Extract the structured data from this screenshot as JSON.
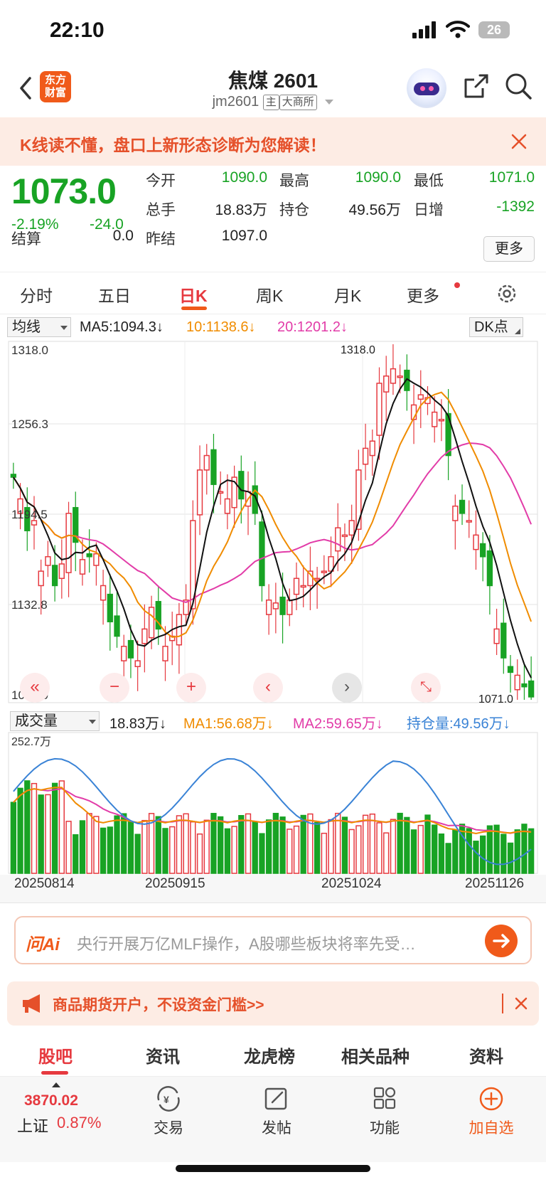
{
  "status_bar": {
    "time": "22:10",
    "battery": "26"
  },
  "header": {
    "logo_line1": "东方",
    "logo_line2": "财富",
    "title": "焦煤 2601",
    "code": "jm2601",
    "tag_main": "主",
    "tag_exchange": "大商所"
  },
  "banner": {
    "text": "K线读不懂，盘口上新形态诊断为您解读！"
  },
  "quote": {
    "price": "1073.0",
    "change_pct": "-2.19%",
    "change": "-24.0",
    "settle_label": "结算",
    "settle": "0.0",
    "prev_settle_label": "昨结",
    "prev_settle": "1097.0",
    "open_label": "今开",
    "open": "1090.0",
    "high_label": "最高",
    "high": "1090.0",
    "low_label": "最低",
    "low": "1071.0",
    "volume_label": "总手",
    "volume": "18.83万",
    "oi_label": "持仓",
    "oi": "49.56万",
    "daily_inc_label": "日增",
    "daily_inc": "-1392",
    "more_label": "更多"
  },
  "period_tabs": [
    "分时",
    "五日",
    "日K",
    "周K",
    "月K",
    "更多"
  ],
  "ma_row": {
    "dropdown": "均线",
    "ma5": "MA5:1094.3↓",
    "ma10": "10:1138.6↓",
    "ma20": "20:1201.2↓",
    "dk": "DK点"
  },
  "kline": {
    "axis_labels": [
      "1318.0",
      "1256.3",
      "1194.5",
      "1132.8",
      "1071.0"
    ],
    "max_marker": "1318.0",
    "min_marker": "1071.0"
  },
  "volume_row": {
    "dropdown": "成交量",
    "vol": "18.83万↓",
    "ma1": "MA1:56.68万↓",
    "ma2": "MA2:59.65万↓",
    "oi": "持仓量:49.56万↓",
    "axis_max": "252.7万"
  },
  "dates": [
    "20250814",
    "20250915",
    "20251024",
    "20251126"
  ],
  "chart_data": {
    "type": "bar",
    "candles_close": [
      1225,
      1210,
      1188,
      1195,
      1160,
      1170,
      1150,
      1165,
      1200,
      1180,
      1168,
      1170,
      1172,
      1150,
      1125,
      1115,
      1108,
      1100,
      1098,
      1120,
      1135,
      1120,
      1108,
      1115,
      1130,
      1140,
      1195,
      1230,
      1240,
      1220,
      1215,
      1210,
      1225,
      1210,
      1215,
      1200,
      1150,
      1140,
      1138,
      1130,
      1140,
      1155,
      1150,
      1160,
      1155,
      1160,
      1170,
      1190,
      1185,
      1195,
      1230,
      1245,
      1250,
      1290,
      1295,
      1300,
      1295,
      1285,
      1275,
      1282,
      1280,
      1270,
      1265,
      1240,
      1205,
      1200,
      1195,
      1185,
      1170,
      1150,
      1120,
      1100,
      1090,
      1088,
      1080,
      1073
    ],
    "ma_labels": {
      "MA5": 1094.3,
      "MA10": 1138.6,
      "MA20": 1201.2
    },
    "volume_axis_max_wan": 252.7,
    "volume_ma": {
      "MA1": 56.68,
      "MA2": 59.65
    },
    "open_interest_wan": 49.56
  },
  "ai_search": {
    "logo": "问Ai",
    "placeholder": "央行开展万亿MLF操作，A股哪些板块将率先受…"
  },
  "ad": {
    "text": "商品期货开户，不设资金门槛>>"
  },
  "bottom_tabs": [
    "股吧",
    "资讯",
    "龙虎榜",
    "相关品种",
    "资料"
  ],
  "toolbar": {
    "index_value": "3870.02",
    "index_name": "上证",
    "index_pct": "0.87%",
    "items": [
      "交易",
      "发帖",
      "功能",
      "加自选"
    ]
  },
  "colors": {
    "up": "#e6393f",
    "down": "#18a324",
    "accent": "#f05a1a",
    "ma5": "#111111",
    "ma10": "#f08c00",
    "ma20": "#e23ca8",
    "oi_line": "#3a83d6"
  }
}
